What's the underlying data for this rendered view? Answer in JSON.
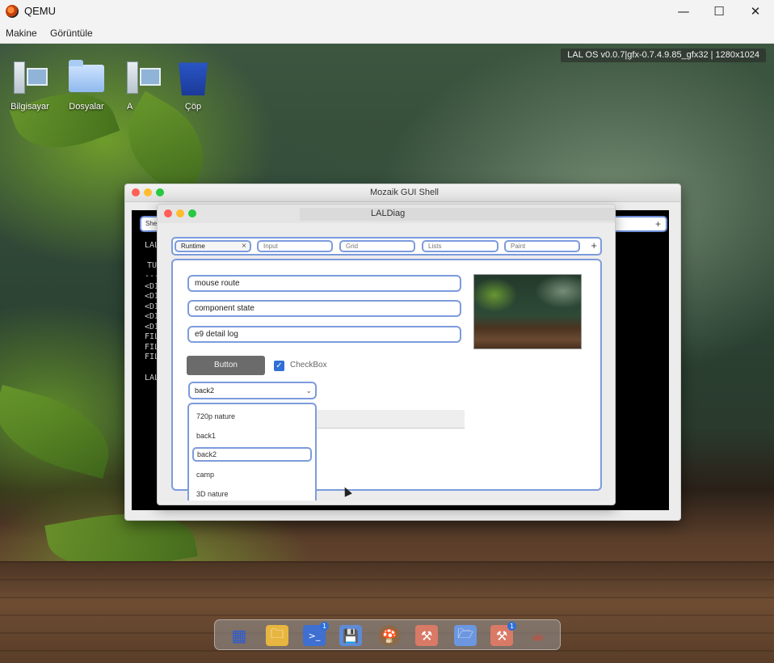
{
  "host": {
    "title": "QEMU",
    "menu": [
      "Makine",
      "Görüntüle"
    ],
    "controls": {
      "minimize": "—",
      "maximize": "☐",
      "close": "✕"
    }
  },
  "desktop": {
    "os_info": "LAL OS v0.0.7|gfx-0.7.4.9.85_gfx32 | 1280x1024",
    "icons": [
      {
        "label": "Bilgisayar",
        "icon": "computer-icon"
      },
      {
        "label": "Dosyalar",
        "icon": "folder-icon"
      },
      {
        "label": "A",
        "icon": "network-icon"
      },
      {
        "label": "Çöp",
        "icon": "trash-icon"
      }
    ]
  },
  "shell": {
    "title": "Mozaik GUI Shell",
    "tab_label": "She",
    "add": "+",
    "lines": [
      "LAL",
      "TU",
      "----",
      "<DI",
      "<DI",
      "<DI",
      "<DI",
      "<DI",
      "FILE",
      "FILE",
      "FILE",
      "LAL"
    ]
  },
  "diag": {
    "title": "LALDiag",
    "tabs": [
      {
        "label": "Runtime",
        "close": "×"
      },
      {
        "label": "Input"
      },
      {
        "label": "Grid"
      },
      {
        "label": "Lists"
      },
      {
        "label": "Paint"
      }
    ],
    "tab_add": "+",
    "fields": [
      "mouse route",
      "component state",
      "e9 detail log"
    ],
    "button_label": "Button",
    "checkbox": {
      "label": "CheckBox",
      "checked": true,
      "mark": "✓"
    },
    "combo": {
      "value": "back2",
      "arrow": "⌄"
    },
    "dropdown": {
      "items": [
        "720p nature",
        "back1",
        "back2",
        "camp",
        "3D nature"
      ],
      "selected": "back2"
    }
  },
  "dock": {
    "items": [
      {
        "icon": "app-grid-icon",
        "glyph": "▦"
      },
      {
        "icon": "files-icon",
        "glyph": "🗀"
      },
      {
        "icon": "terminal-icon",
        "glyph": ">_",
        "badge": "1"
      },
      {
        "icon": "save-icon",
        "glyph": "💾"
      },
      {
        "icon": "mushroom-icon",
        "glyph": "🍄"
      },
      {
        "icon": "tool-icon",
        "glyph": "⚒"
      },
      {
        "icon": "folder-search-icon",
        "glyph": "🗁"
      },
      {
        "icon": "tool-badge-icon",
        "glyph": "⚒",
        "badge": "1"
      },
      {
        "icon": "java-icon",
        "glyph": "☕"
      }
    ]
  },
  "colors": {
    "accent": "#7d9bdc",
    "checkbox": "#2f6fd6",
    "button": "#6b6b6b"
  }
}
